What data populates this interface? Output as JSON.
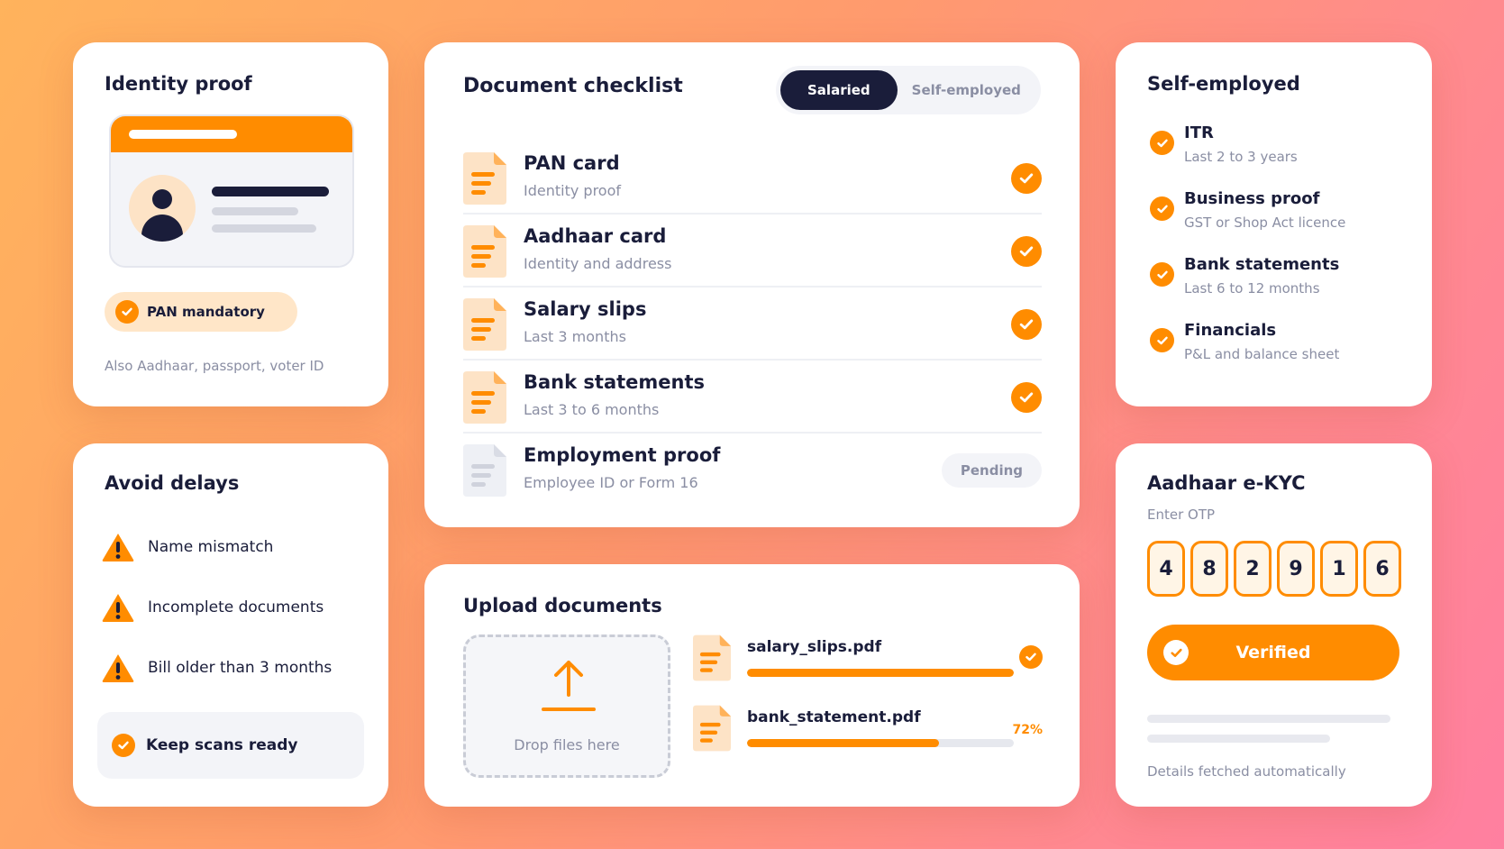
{
  "colors": {
    "accent": "#ff8c00",
    "dark": "#1a1d3a",
    "muted": "#8a8ea3",
    "soft": "#ffe6c8"
  },
  "identity": {
    "title": "Identity proof",
    "badge": "PAN mandatory",
    "note": "Also Aadhaar, passport, voter ID"
  },
  "delays": {
    "title": "Avoid delays",
    "warnings": [
      "Name mismatch",
      "Incomplete documents",
      "Bill older than 3 months"
    ],
    "tip": "Keep scans ready"
  },
  "checklist": {
    "title": "Document checklist",
    "tabs": [
      "Salaried",
      "Self-employed"
    ],
    "active_tab": "Salaried",
    "items": [
      {
        "name": "PAN card",
        "sub": "Identity proof",
        "status": "done"
      },
      {
        "name": "Aadhaar card",
        "sub": "Identity and address",
        "status": "done"
      },
      {
        "name": "Salary slips",
        "sub": "Last 3 months",
        "status": "done"
      },
      {
        "name": "Bank statements",
        "sub": "Last 3 to 6 months",
        "status": "done"
      },
      {
        "name": "Employment proof",
        "sub": "Employee ID or Form 16",
        "status": "pending",
        "badge": "Pending"
      }
    ]
  },
  "upload": {
    "title": "Upload documents",
    "drop_label": "Drop files here",
    "files": [
      {
        "name": "salary_slips.pdf",
        "progress": 100,
        "status": "done"
      },
      {
        "name": "bank_statement.pdf",
        "progress": 72,
        "status": "uploading",
        "progress_label": "72%"
      }
    ]
  },
  "self_employed": {
    "title": "Self-employed",
    "items": [
      {
        "title": "ITR",
        "sub": "Last 2 to 3 years"
      },
      {
        "title": "Business proof",
        "sub": "GST or Shop Act licence"
      },
      {
        "title": "Bank statements",
        "sub": "Last 6 to 12 months"
      },
      {
        "title": "Financials",
        "sub": "P&L and balance sheet"
      }
    ]
  },
  "aadhaar": {
    "title": "Aadhaar e-KYC",
    "otp_label": "Enter OTP",
    "otp": [
      "4",
      "8",
      "2",
      "9",
      "1",
      "6"
    ],
    "button": "Verified",
    "note": "Details fetched automatically"
  }
}
